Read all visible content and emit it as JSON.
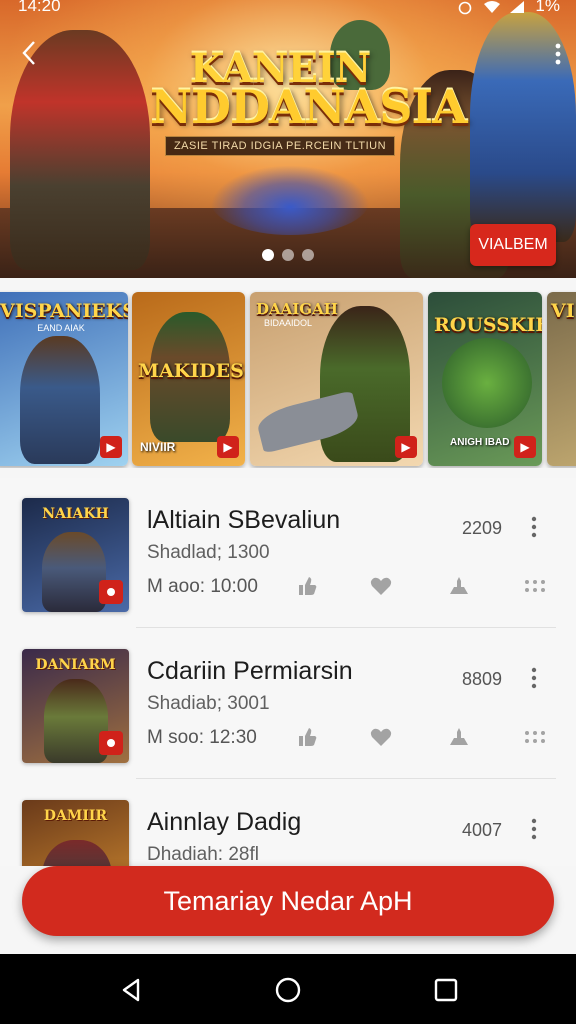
{
  "status_bar": {
    "time": "14:20",
    "battery": "1%"
  },
  "hero": {
    "title_line1": "KANEIN",
    "title_line2": "NDDANASIA",
    "tagline": "ZASIE TIRAD IDGIA PE.RCEIN TLTIUN",
    "cta_label": "VIALBEM",
    "page_count": 3,
    "active_page": 1
  },
  "carousel": [
    {
      "title": "VISPANIEKS",
      "subtitle": "EAND AIAK",
      "bottom_label": "",
      "colors": [
        "#3f6fb8",
        "#9fd2f0"
      ]
    },
    {
      "title": "MAKIDES",
      "subtitle": "",
      "bottom_label": "NIVIIR",
      "colors": [
        "#b96a1a",
        "#f2b24a"
      ]
    },
    {
      "title": "DAAIGAH",
      "subtitle": "BIDAAIDOL",
      "bottom_label": "",
      "colors": [
        "#c8a070",
        "#f3d8b0"
      ]
    },
    {
      "title": "ROUSSKIH",
      "subtitle": "",
      "bottom_label": "ANIGH IBAD",
      "colors": [
        "#2c4d3a",
        "#6a9a58"
      ]
    },
    {
      "title": "VI",
      "subtitle": "",
      "bottom_label": "",
      "colors": [
        "#7a6a4a",
        "#c0a870"
      ]
    }
  ],
  "list": [
    {
      "title": "lAltiain SBevaliun",
      "subtitle": "Shadlad; 1300",
      "time": "M aoo: 10:00",
      "count": "2209",
      "thumb_title": "NAIAKH",
      "thumb_colors": [
        "#1c2a4a",
        "#4a6aa8"
      ]
    },
    {
      "title": "Cdariin Permiarsin",
      "subtitle": "Shadiab; 3001",
      "time": "M soo: 12:30",
      "count": "8809",
      "thumb_title": "DANIARM",
      "thumb_colors": [
        "#3a2a4a",
        "#a07040"
      ]
    },
    {
      "title": "Ainnlay Dadig",
      "subtitle": "Dhadiah: 28fl",
      "time": "",
      "count": "4007",
      "thumb_title": "DAMIIR",
      "thumb_colors": [
        "#6a3a1a",
        "#d08a30"
      ]
    }
  ],
  "cta": {
    "label": "Temariay Nedar ApH"
  },
  "accent": "#d22a1e"
}
